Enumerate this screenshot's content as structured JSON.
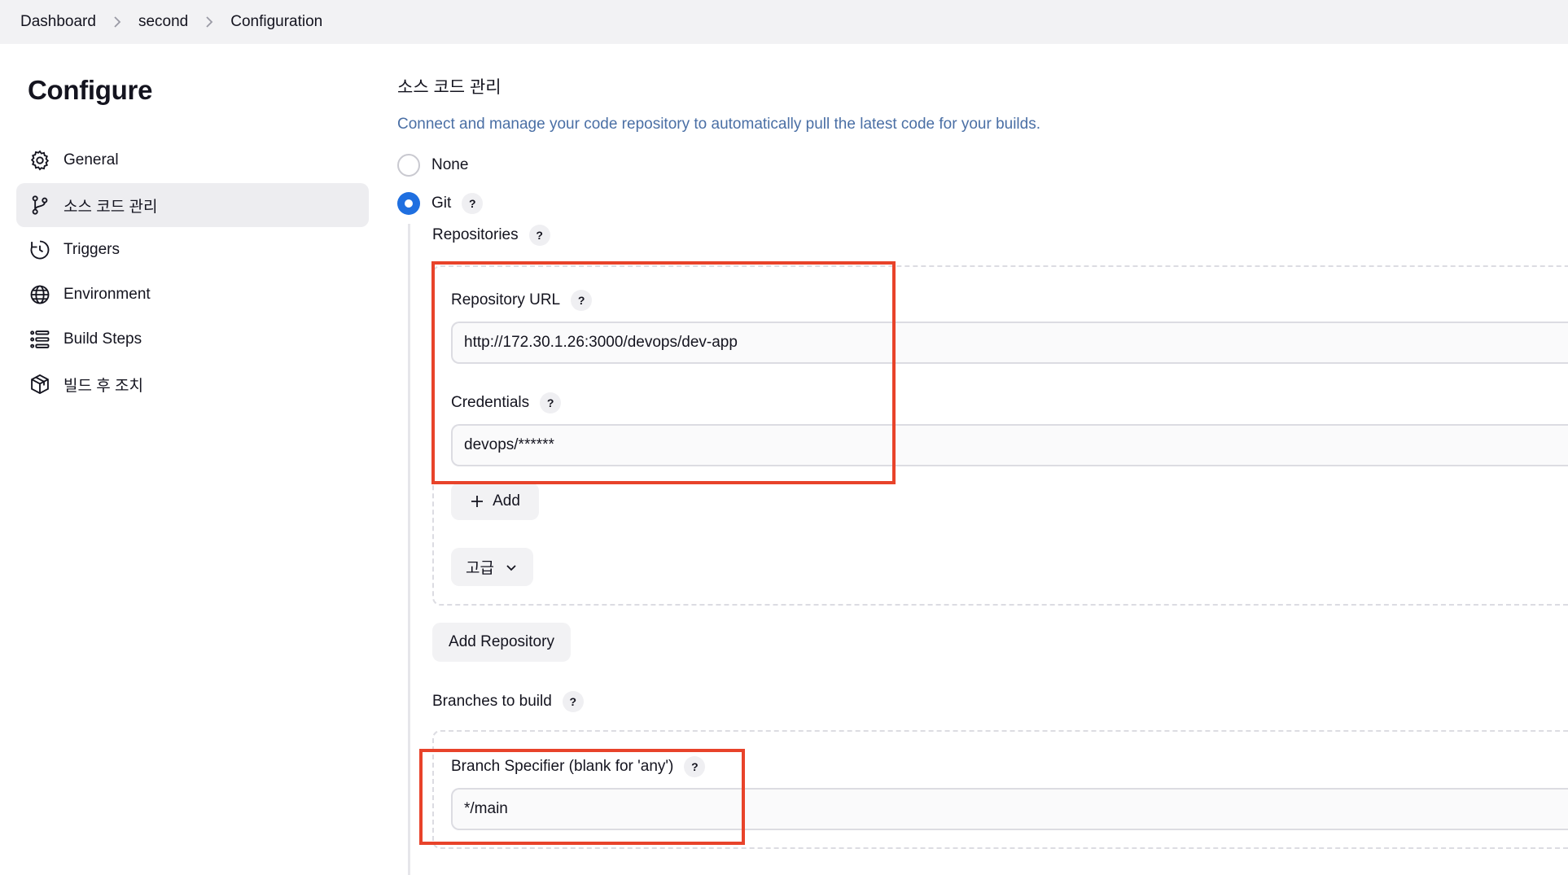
{
  "breadcrumb": {
    "items": [
      "Dashboard",
      "second",
      "Configuration"
    ]
  },
  "sidebar": {
    "title": "Configure",
    "items": [
      {
        "label": "General",
        "icon": "gear-icon"
      },
      {
        "label": "소스 코드 관리",
        "icon": "git-branch-icon",
        "active": true
      },
      {
        "label": "Triggers",
        "icon": "clock-icon"
      },
      {
        "label": "Environment",
        "icon": "globe-icon"
      },
      {
        "label": "Build Steps",
        "icon": "list-icon"
      },
      {
        "label": "빌드 후 조치",
        "icon": "package-icon"
      }
    ]
  },
  "scm": {
    "title": "소스 코드 관리",
    "description": "Connect and manage your code repository to automatically pull the latest code for your builds.",
    "options": {
      "none_label": "None",
      "git_label": "Git",
      "selected": "Git"
    },
    "help_glyph": "?",
    "repositories_label": "Repositories",
    "repository_url_label": "Repository URL",
    "repository_url_value": "http://172.30.1.26:3000/devops/dev-app",
    "credentials_label": "Credentials",
    "credentials_value": "devops/******",
    "add_label": "Add",
    "advanced_label": "고급",
    "add_repository_label": "Add Repository",
    "branches_label": "Branches to build",
    "branch_specifier_label": "Branch Specifier (blank for 'any')",
    "branch_specifier_value": "*/main"
  },
  "colors": {
    "accent": "#1f6fe0",
    "highlight": "#e8432a",
    "description": "#4a6fa5"
  }
}
